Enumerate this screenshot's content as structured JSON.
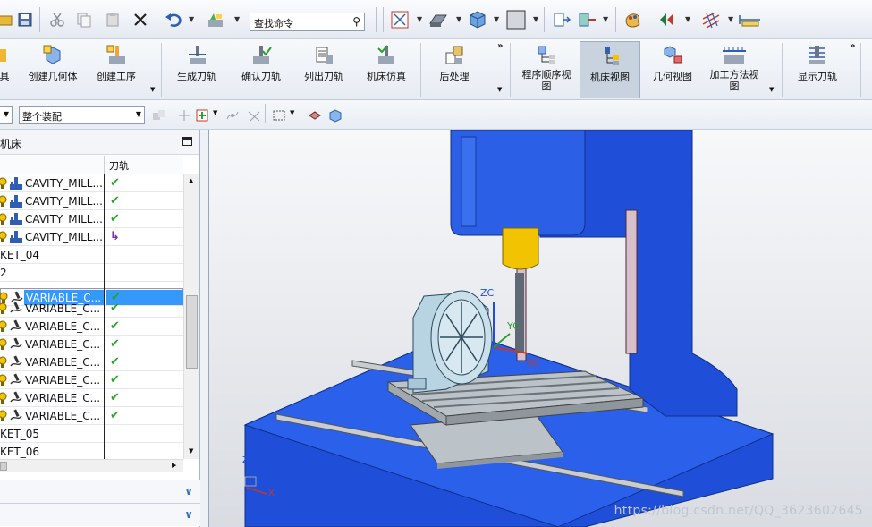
{
  "quick_toolbar": {
    "command_search": {
      "value": "查找命令",
      "icon": "magnifier-icon"
    }
  },
  "ribbon": {
    "left_cut_label": "具",
    "buttons": [
      {
        "label": "创建几何体",
        "icon": "create-geometry-icon"
      },
      {
        "label": "创建工序",
        "icon": "create-operation-icon"
      },
      {
        "label": "生成刀轨",
        "icon": "generate-toolpath-icon"
      },
      {
        "label": "确认刀轨",
        "icon": "verify-toolpath-icon"
      },
      {
        "label": "列出刀轨",
        "icon": "list-toolpath-icon"
      },
      {
        "label": "机床仿真",
        "icon": "machine-simulate-icon"
      },
      {
        "label": "后处理",
        "icon": "postprocess-icon"
      },
      {
        "label": "程序顺序视图",
        "icon": "program-order-view-icon"
      },
      {
        "label": "机床视图",
        "icon": "machine-view-icon",
        "active": true
      },
      {
        "label": "几何视图",
        "icon": "geometry-view-icon"
      },
      {
        "label": "加工方法视图",
        "icon": "machining-method-view-icon"
      },
      {
        "label": "显示刀轨",
        "icon": "display-toolpath-icon"
      }
    ]
  },
  "secondary_toolbar": {
    "filter_select": "整个装配"
  },
  "navigator": {
    "title_fragment": "机床",
    "column_toolpath": "刀轨",
    "rows": [
      {
        "name": "CAVITY_MILL...",
        "status": "check",
        "kind": "op"
      },
      {
        "name": "CAVITY_MILL...",
        "status": "check",
        "kind": "op"
      },
      {
        "name": "CAVITY_MILL...",
        "status": "check",
        "kind": "op"
      },
      {
        "name": "CAVITY_MILL...",
        "status": "arrow",
        "kind": "op"
      },
      {
        "name": "KET_04",
        "status": "",
        "kind": "group"
      },
      {
        "name": "2",
        "status": "",
        "kind": "group"
      },
      {
        "name": "VARIABLE_C...",
        "status": "check",
        "kind": "op",
        "selected": true
      },
      {
        "name": "VARIABLE_C...",
        "status": "check",
        "kind": "op"
      },
      {
        "name": "VARIABLE_C...",
        "status": "check",
        "kind": "op"
      },
      {
        "name": "VARIABLE_C...",
        "status": "check",
        "kind": "op"
      },
      {
        "name": "VARIABLE_C...",
        "status": "check",
        "kind": "op"
      },
      {
        "name": "VARIABLE_C...",
        "status": "check",
        "kind": "op"
      },
      {
        "name": "VARIABLE_C...",
        "status": "check",
        "kind": "op"
      },
      {
        "name": "VARIABLE_C...",
        "status": "check",
        "kind": "op"
      },
      {
        "name": "KET_05",
        "status": "",
        "kind": "group"
      },
      {
        "name": "KET_06",
        "status": "",
        "kind": "group"
      }
    ]
  },
  "graphics": {
    "axis_labels": {
      "zc": "ZC",
      "yc": "YC",
      "xc": "XC"
    },
    "triad_labels": {
      "z": "Z",
      "x": "X"
    },
    "watermark": "https://blog.csdn.net/QQ_3623602645",
    "colors": {
      "machine_blue": "#1f4fd8",
      "spindle_yellow": "#f2c300",
      "table_gray": "#bcc3c8",
      "rotary_teal": "#a9c6d6"
    }
  }
}
